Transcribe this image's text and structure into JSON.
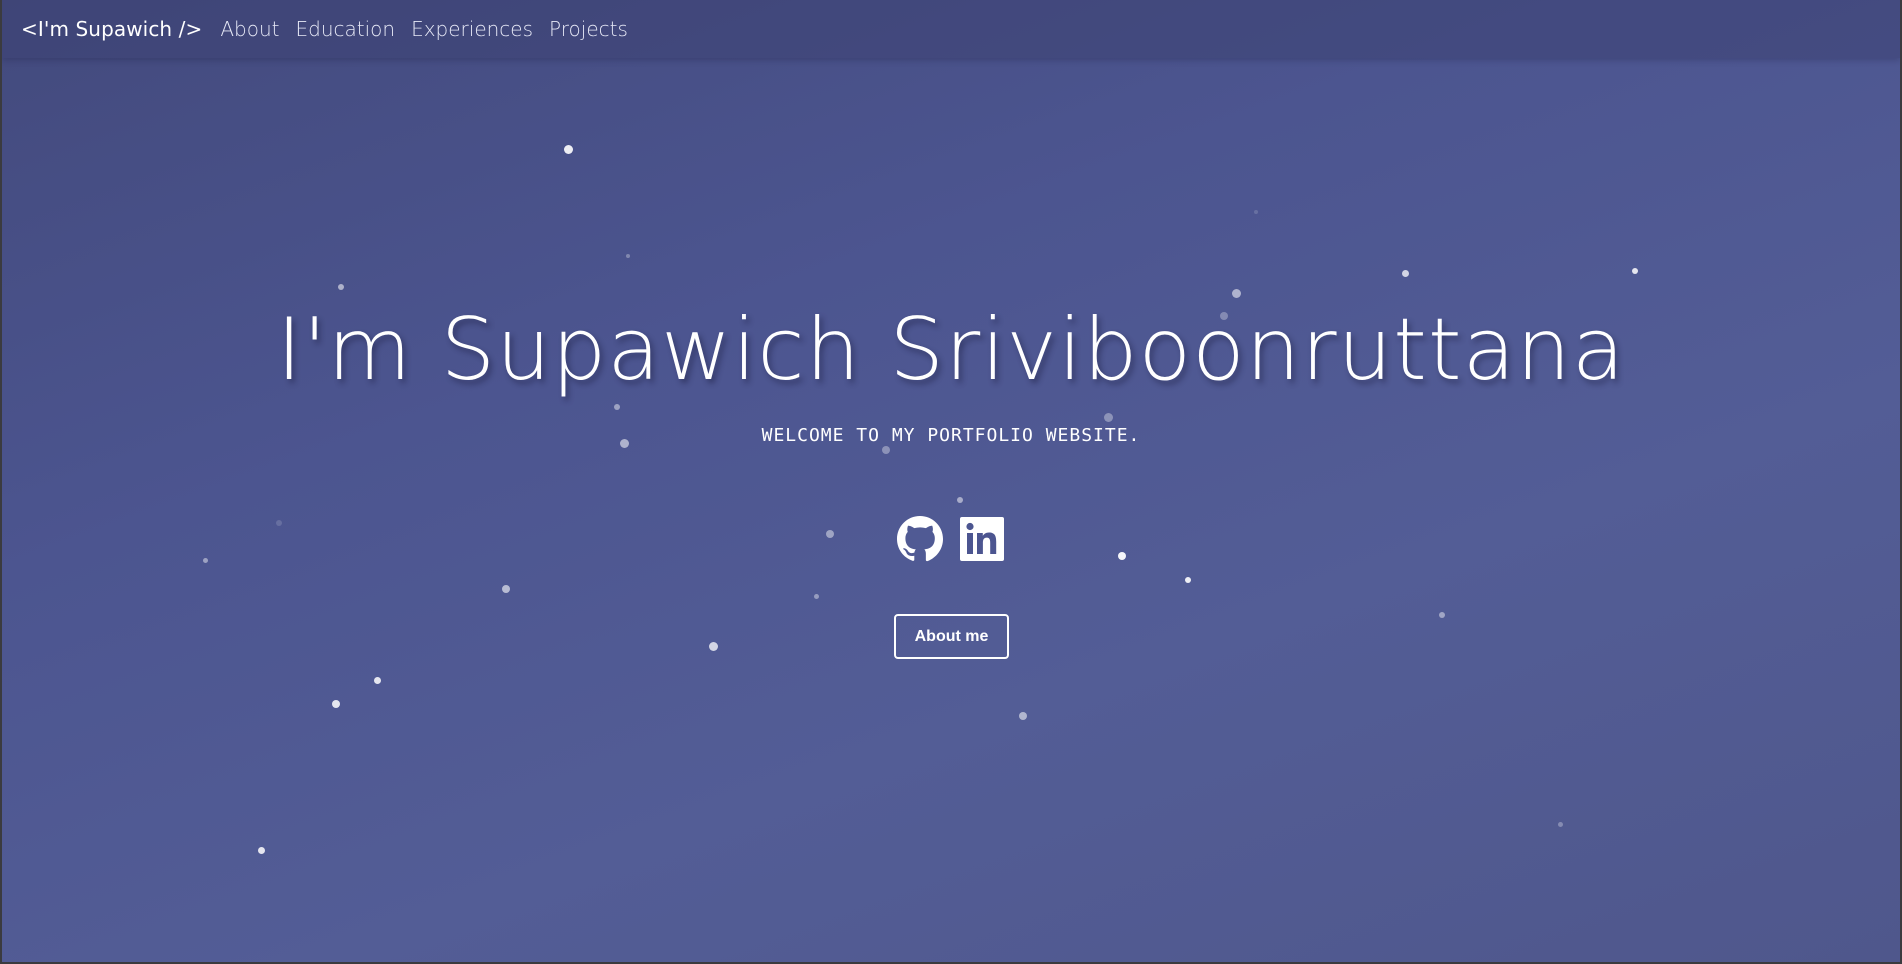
{
  "navbar": {
    "brand": "<I'm Supawich />",
    "links": [
      "About",
      "Education",
      "Experiences",
      "Projects"
    ]
  },
  "hero": {
    "title": "I'm Supawich Sriviboonruttana",
    "subtitle": "WELCOME TO MY PORTFOLIO WEBSITE.",
    "about_button": "About me"
  },
  "icons": {
    "github": "github-icon",
    "linkedin": "linkedin-icon"
  },
  "colors": {
    "background": "#4c5590",
    "navbar": "#3c4273",
    "text": "#ffffff"
  }
}
